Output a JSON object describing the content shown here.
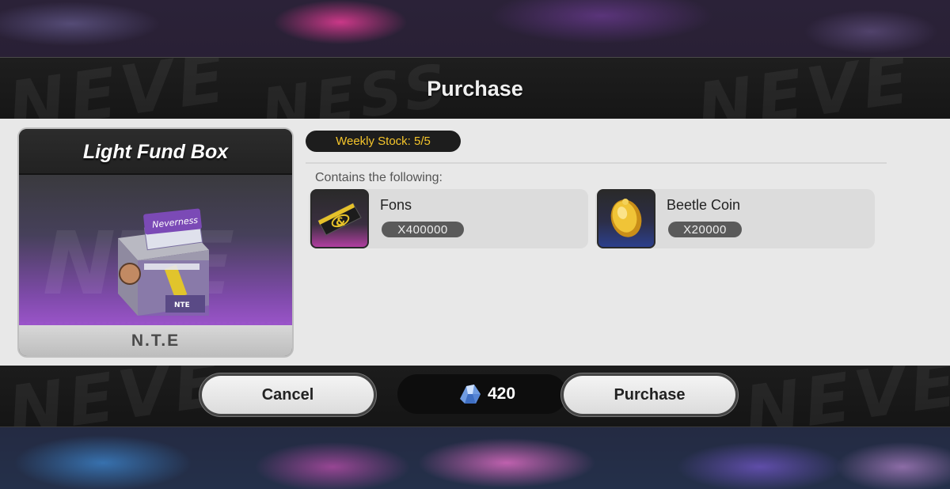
{
  "dialog": {
    "title": "Purchase"
  },
  "item": {
    "name": "Light Fund Box",
    "footer_label": "N.T.E",
    "package_label": "Neverness",
    "package_tag": "NTE"
  },
  "stock": {
    "label": "Weekly Stock:",
    "value": "5/5"
  },
  "contents": {
    "label": "Contains the following:",
    "rewards": [
      {
        "name": "Fons",
        "quantity": "X400000",
        "icon": "fons-card-icon"
      },
      {
        "name": "Beetle Coin",
        "quantity": "X20000",
        "icon": "beetle-coin-icon"
      }
    ]
  },
  "actions": {
    "cancel_label": "Cancel",
    "purchase_label": "Purchase"
  },
  "cost": {
    "amount": "420",
    "currency_icon": "crystal-currency-icon"
  },
  "colors": {
    "stock_text": "#f5c52b",
    "fons_frame": "#b03ea0",
    "beetle_frame": "#2c3f8c",
    "card_art": "#9a54c9"
  }
}
